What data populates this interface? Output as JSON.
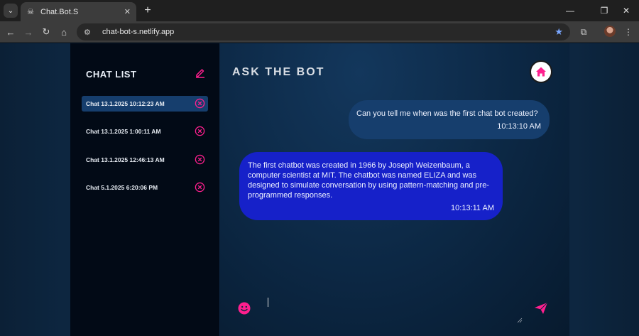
{
  "browser": {
    "tab_title": "Chat.Bot.S",
    "url": "chat-bot-s.netlify.app"
  },
  "sidebar": {
    "title": "CHAT LIST",
    "chats": [
      {
        "label": "Chat 13.1.2025 10:12:23 AM",
        "active": true
      },
      {
        "label": "Chat 13.1.2025 1:00:11 AM",
        "active": false
      },
      {
        "label": "Chat 13.1.2025 12:46:13 AM",
        "active": false
      },
      {
        "label": "Chat 5.1.2025 6:20:06 PM",
        "active": false
      }
    ]
  },
  "main": {
    "title": "ASK THE BOT",
    "messages": [
      {
        "role": "user",
        "text": "Can you tell me when was the first chat bot created?",
        "time": "10:13:10 AM"
      },
      {
        "role": "bot",
        "text": "The first chatbot was created in 1966 by Joseph Weizenbaum, a computer scientist at MIT. The chatbot was named ELIZA and was designed to simulate conversation by using pattern-matching and pre-programmed responses.",
        "time": "10:13:11 AM"
      }
    ],
    "input_value": ""
  },
  "colors": {
    "accent": "#ff1f8e",
    "user_bubble": "#163e6d",
    "bot_bubble": "#1621c9",
    "sidebar_bg": "#020a16"
  },
  "icons": {
    "edit": "edit-icon",
    "delete": "close-circle-icon",
    "home": "home-icon",
    "emoji": "emoji-icon",
    "send": "send-icon"
  }
}
